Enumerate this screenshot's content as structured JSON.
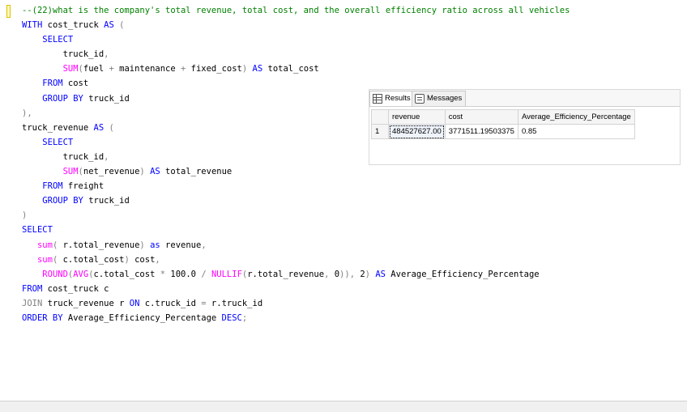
{
  "editor": {
    "lines": [
      [
        {
          "c": "cm",
          "t": "--(22)what is the company's total revenue, total cost, and the overall efficiency ratio across all vehicles"
        }
      ],
      [
        {
          "c": "kw",
          "t": "WITH"
        },
        {
          "c": "txt",
          "t": " cost_truck "
        },
        {
          "c": "kw",
          "t": "AS"
        },
        {
          "c": "gr",
          "t": " ("
        }
      ],
      [
        {
          "c": "txt",
          "t": "    "
        },
        {
          "c": "kw",
          "t": "SELECT"
        }
      ],
      [
        {
          "c": "txt",
          "t": "        truck_id"
        },
        {
          "c": "gr",
          "t": ","
        }
      ],
      [
        {
          "c": "txt",
          "t": "        "
        },
        {
          "c": "fn",
          "t": "SUM"
        },
        {
          "c": "gr",
          "t": "("
        },
        {
          "c": "txt",
          "t": "fuel "
        },
        {
          "c": "gr",
          "t": "+"
        },
        {
          "c": "txt",
          "t": " maintenance "
        },
        {
          "c": "gr",
          "t": "+"
        },
        {
          "c": "txt",
          "t": " fixed_cost"
        },
        {
          "c": "gr",
          "t": ")"
        },
        {
          "c": "txt",
          "t": " "
        },
        {
          "c": "kw",
          "t": "AS"
        },
        {
          "c": "txt",
          "t": " total_cost"
        }
      ],
      [
        {
          "c": "txt",
          "t": "    "
        },
        {
          "c": "kw",
          "t": "FROM"
        },
        {
          "c": "txt",
          "t": " cost"
        }
      ],
      [
        {
          "c": "txt",
          "t": "    "
        },
        {
          "c": "kw",
          "t": "GROUP BY"
        },
        {
          "c": "txt",
          "t": " truck_id"
        }
      ],
      [
        {
          "c": "gr",
          "t": "),"
        }
      ],
      [
        {
          "c": "txt",
          "t": "truck_revenue "
        },
        {
          "c": "kw",
          "t": "AS"
        },
        {
          "c": "gr",
          "t": " ("
        }
      ],
      [
        {
          "c": "txt",
          "t": "    "
        },
        {
          "c": "kw",
          "t": "SELECT"
        }
      ],
      [
        {
          "c": "txt",
          "t": "        truck_id"
        },
        {
          "c": "gr",
          "t": ","
        }
      ],
      [
        {
          "c": "txt",
          "t": "        "
        },
        {
          "c": "fn",
          "t": "SUM"
        },
        {
          "c": "gr",
          "t": "("
        },
        {
          "c": "txt",
          "t": "net_revenue"
        },
        {
          "c": "gr",
          "t": ")"
        },
        {
          "c": "txt",
          "t": " "
        },
        {
          "c": "kw",
          "t": "AS"
        },
        {
          "c": "txt",
          "t": " total_revenue"
        }
      ],
      [
        {
          "c": "txt",
          "t": "    "
        },
        {
          "c": "kw",
          "t": "FROM"
        },
        {
          "c": "txt",
          "t": " freight"
        }
      ],
      [
        {
          "c": "txt",
          "t": "    "
        },
        {
          "c": "kw",
          "t": "GROUP BY"
        },
        {
          "c": "txt",
          "t": " truck_id"
        }
      ],
      [
        {
          "c": "gr",
          "t": ")"
        }
      ],
      [
        {
          "c": "kw",
          "t": "SELECT"
        }
      ],
      [
        {
          "c": "txt",
          "t": "   "
        },
        {
          "c": "fn",
          "t": "sum"
        },
        {
          "c": "gr",
          "t": "("
        },
        {
          "c": "txt",
          "t": " r.total_revenue"
        },
        {
          "c": "gr",
          "t": ")"
        },
        {
          "c": "txt",
          "t": " "
        },
        {
          "c": "kw",
          "t": "as"
        },
        {
          "c": "txt",
          "t": " revenue"
        },
        {
          "c": "gr",
          "t": ","
        }
      ],
      [
        {
          "c": "txt",
          "t": "   "
        },
        {
          "c": "fn",
          "t": "sum"
        },
        {
          "c": "gr",
          "t": "("
        },
        {
          "c": "txt",
          "t": " c.total_cost"
        },
        {
          "c": "gr",
          "t": ")"
        },
        {
          "c": "txt",
          "t": " cost"
        },
        {
          "c": "gr",
          "t": ","
        }
      ],
      [
        {
          "c": "txt",
          "t": "    "
        },
        {
          "c": "fn",
          "t": "ROUND"
        },
        {
          "c": "gr",
          "t": "("
        },
        {
          "c": "fn",
          "t": "AVG"
        },
        {
          "c": "gr",
          "t": "("
        },
        {
          "c": "txt",
          "t": "c.total_cost "
        },
        {
          "c": "gr",
          "t": "*"
        },
        {
          "c": "txt",
          "t": " 100.0 "
        },
        {
          "c": "gr",
          "t": "/"
        },
        {
          "c": "txt",
          "t": " "
        },
        {
          "c": "fn",
          "t": "NULLIF"
        },
        {
          "c": "gr",
          "t": "("
        },
        {
          "c": "txt",
          "t": "r.total_revenue"
        },
        {
          "c": "gr",
          "t": ","
        },
        {
          "c": "txt",
          "t": " 0"
        },
        {
          "c": "gr",
          "t": ")),"
        },
        {
          "c": "txt",
          "t": " 2"
        },
        {
          "c": "gr",
          "t": ")"
        },
        {
          "c": "txt",
          "t": " "
        },
        {
          "c": "kw",
          "t": "AS"
        },
        {
          "c": "txt",
          "t": " Average_Efficiency_Percentage"
        }
      ],
      [
        {
          "c": "kw",
          "t": "FROM"
        },
        {
          "c": "txt",
          "t": " cost_truck c"
        }
      ],
      [
        {
          "c": "gr",
          "t": "JOIN"
        },
        {
          "c": "txt",
          "t": " truck_revenue r "
        },
        {
          "c": "kw",
          "t": "ON"
        },
        {
          "c": "txt",
          "t": " c.truck_id "
        },
        {
          "c": "gr",
          "t": "="
        },
        {
          "c": "txt",
          "t": " r.truck_id"
        }
      ],
      [
        {
          "c": "kw",
          "t": "ORDER BY"
        },
        {
          "c": "txt",
          "t": " Average_Efficiency_Percentage "
        },
        {
          "c": "kw",
          "t": "DESC"
        },
        {
          "c": "gr",
          "t": ";"
        }
      ]
    ]
  },
  "results": {
    "tabs": [
      {
        "label": "Results",
        "icon": "grid-icon"
      },
      {
        "label": "Messages",
        "icon": "messages-icon"
      }
    ],
    "columns": [
      "revenue",
      "cost",
      "Average_Efficiency_Percentage"
    ],
    "rows": [
      {
        "num": "1",
        "cells": [
          "484527627.00",
          "3771511.19503375",
          "0.85"
        ]
      }
    ]
  }
}
